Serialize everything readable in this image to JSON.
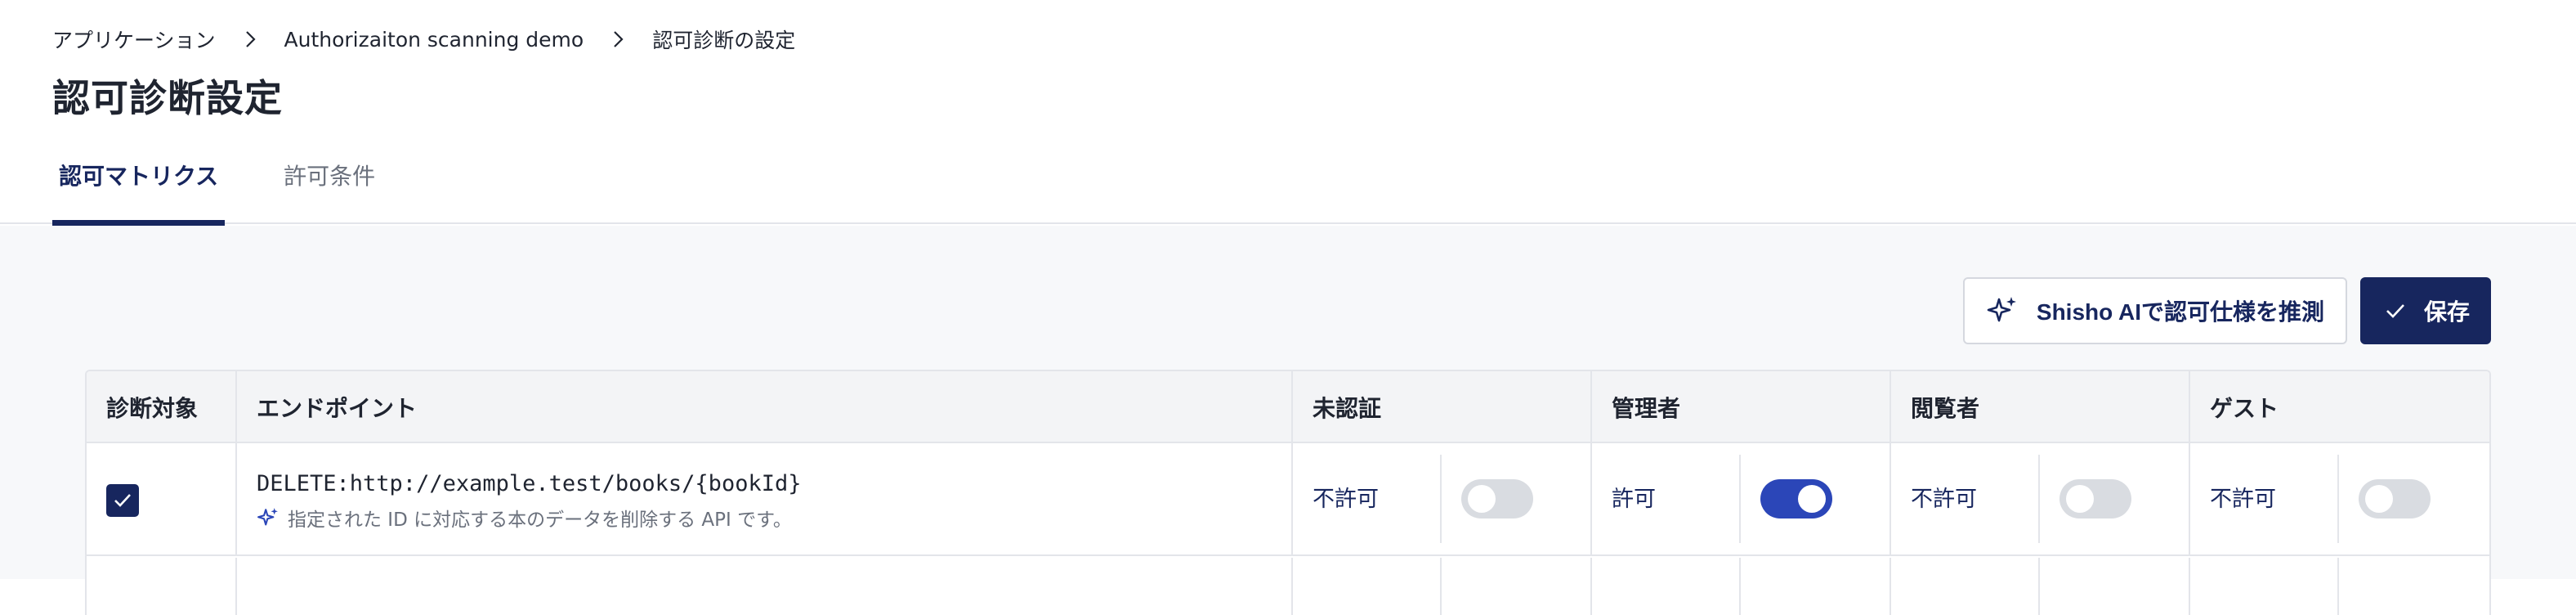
{
  "breadcrumb": {
    "items": [
      "アプリケーション",
      "Authorizaiton scanning demo",
      "認可診断の設定"
    ]
  },
  "page": {
    "title": "認可診断設定"
  },
  "tabs": [
    {
      "label": "認可マトリクス",
      "active": true
    },
    {
      "label": "許可条件",
      "active": false
    }
  ],
  "toolbar": {
    "ai_label": "Shisho AIで認可仕様を推測",
    "save_label": "保存"
  },
  "table": {
    "headers": [
      "診断対象",
      "エンドポイント",
      "未認証",
      "管理者",
      "閲覧者",
      "ゲスト"
    ],
    "rows": [
      {
        "checked": true,
        "endpoint": "DELETE:http://example.test/books/{bookId}",
        "description": "指定された ID に対応する本のデータを削除する API です。",
        "permissions": [
          {
            "label": "不許可",
            "enabled": false
          },
          {
            "label": "許可",
            "enabled": true
          },
          {
            "label": "不許可",
            "enabled": false
          },
          {
            "label": "不許可",
            "enabled": false
          }
        ]
      }
    ]
  },
  "colors": {
    "accent": "#17265e",
    "toggle_on": "#2b46b8",
    "toggle_off": "#d9dce1"
  }
}
